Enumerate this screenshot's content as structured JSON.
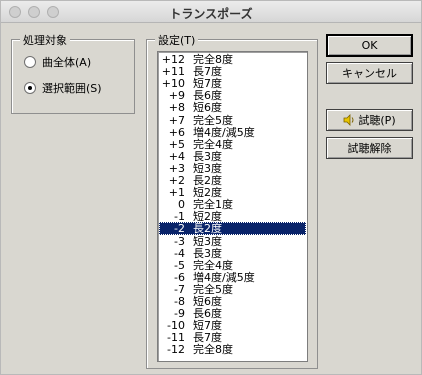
{
  "window": {
    "title": "トランスポーズ"
  },
  "processing_target": {
    "label": "処理対象",
    "options": [
      {
        "label": "曲全体(A)",
        "checked": false
      },
      {
        "label": "選択範囲(S)",
        "checked": true
      }
    ]
  },
  "settings": {
    "label": "設定(T)",
    "items": [
      {
        "num": "+12",
        "name": "完全8度"
      },
      {
        "num": "+11",
        "name": "長7度"
      },
      {
        "num": "+10",
        "name": "短7度"
      },
      {
        "num": "+9",
        "name": "長6度"
      },
      {
        "num": "+8",
        "name": "短6度"
      },
      {
        "num": "+7",
        "name": "完全5度"
      },
      {
        "num": "+6",
        "name": "増4度/減5度"
      },
      {
        "num": "+5",
        "name": "完全4度"
      },
      {
        "num": "+4",
        "name": "長3度"
      },
      {
        "num": "+3",
        "name": "短3度"
      },
      {
        "num": "+2",
        "name": "長2度"
      },
      {
        "num": "+1",
        "name": "短2度"
      },
      {
        "num": "0",
        "name": "完全1度"
      },
      {
        "num": "-1",
        "name": "短2度"
      },
      {
        "num": "-2",
        "name": "長2度"
      },
      {
        "num": "-3",
        "name": "短3度"
      },
      {
        "num": "-4",
        "name": "長3度"
      },
      {
        "num": "-5",
        "name": "完全4度"
      },
      {
        "num": "-6",
        "name": "増4度/減5度"
      },
      {
        "num": "-7",
        "name": "完全5度"
      },
      {
        "num": "-8",
        "name": "短6度"
      },
      {
        "num": "-9",
        "name": "長6度"
      },
      {
        "num": "-10",
        "name": "短7度"
      },
      {
        "num": "-11",
        "name": "長7度"
      },
      {
        "num": "-12",
        "name": "完全8度"
      }
    ],
    "selected": "-2"
  },
  "buttons": {
    "ok": "OK",
    "cancel": "キャンセル",
    "preview": "試聴(P)",
    "preview_cancel": "試聴解除"
  },
  "icons": {
    "preview": "speaker-icon"
  },
  "colors": {
    "selection": "#0a246a"
  }
}
